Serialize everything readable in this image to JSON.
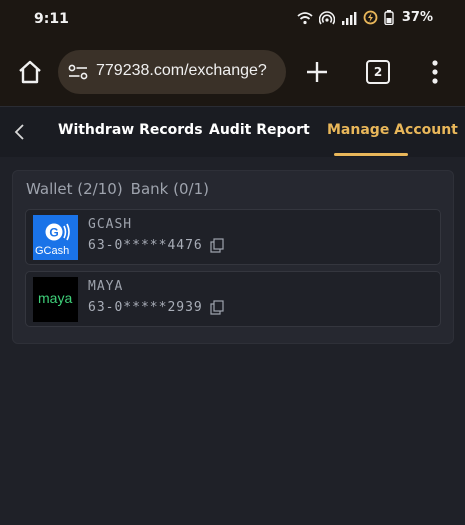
{
  "status_bar": {
    "time": "9:11",
    "battery": "37%"
  },
  "browser": {
    "url": "779238.com/exchange?",
    "tab_count": "2"
  },
  "nav": {
    "tabs": [
      {
        "label": "Withdraw Records"
      },
      {
        "label": "Audit Report"
      },
      {
        "label": "Manage Account"
      }
    ],
    "active_tab": "Manage Account",
    "accent_color": "#e9b75a"
  },
  "panel": {
    "wallet_label": "Wallet (2/10)",
    "bank_label": "Bank (0/1)",
    "accounts": [
      {
        "name": "GCASH",
        "number": "63-0*****4476",
        "logo_text": "GCash",
        "logo_color": "#1a73e8"
      },
      {
        "name": "MAYA",
        "number": "63-0*****2939",
        "logo_text": "maya",
        "logo_color": "#000000"
      }
    ]
  }
}
